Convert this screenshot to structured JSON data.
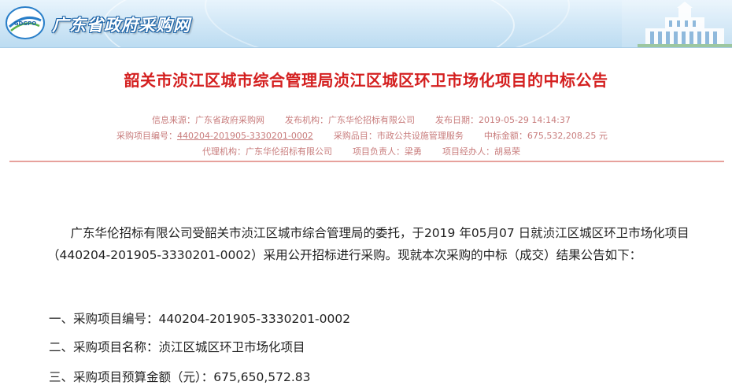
{
  "header": {
    "site_name": "广东省政府采购网",
    "logo_text": "GDGPO"
  },
  "title": "韶关市浈江区城市综合管理局浈江区城区环卫市场化项目的中标公告",
  "meta": {
    "source_label": "信息来源：",
    "source_value": "广东省政府采购网",
    "publisher_label": "发布机构：",
    "publisher_value": "广东华伦招标有限公司",
    "date_label": "发布日期：",
    "date_value": "2019-05-29 14:14:37",
    "project_no_label": "采购项目编号：",
    "project_no_value": "440204-201905-3330201-0002",
    "category_label": "采购品目：",
    "category_value": "市政公共设施管理服务",
    "amount_label": "中标金额：",
    "amount_value": "675,532,208.25 元",
    "agency_label": "代理机构：",
    "agency_value": "广东华伦招标有限公司",
    "leader_label": "项目负责人：",
    "leader_value": "梁勇",
    "handler_label": "项目经办人：",
    "handler_value": "胡易荣"
  },
  "body": {
    "intro": "广东华伦招标有限公司受韶关市浈江区城市综合管理局的委托，于2019 年05月07 日就浈江区城区环卫市场化项目（440204-201905-3330201-0002）采用公开招标进行采购。现就本次采购的中标（成交）结果公告如下：",
    "items": [
      "一、采购项目编号：440204-201905-3330201-0002",
      "二、采购项目名称：浈江区城区环卫市场化项目",
      "三、采购项目预算金额（元）：675,650,572.83"
    ]
  },
  "colors": {
    "title": "#d41f1f",
    "meta": "#c87c7c",
    "divider": "#e7a19c",
    "banner": "#cfe6f6"
  }
}
